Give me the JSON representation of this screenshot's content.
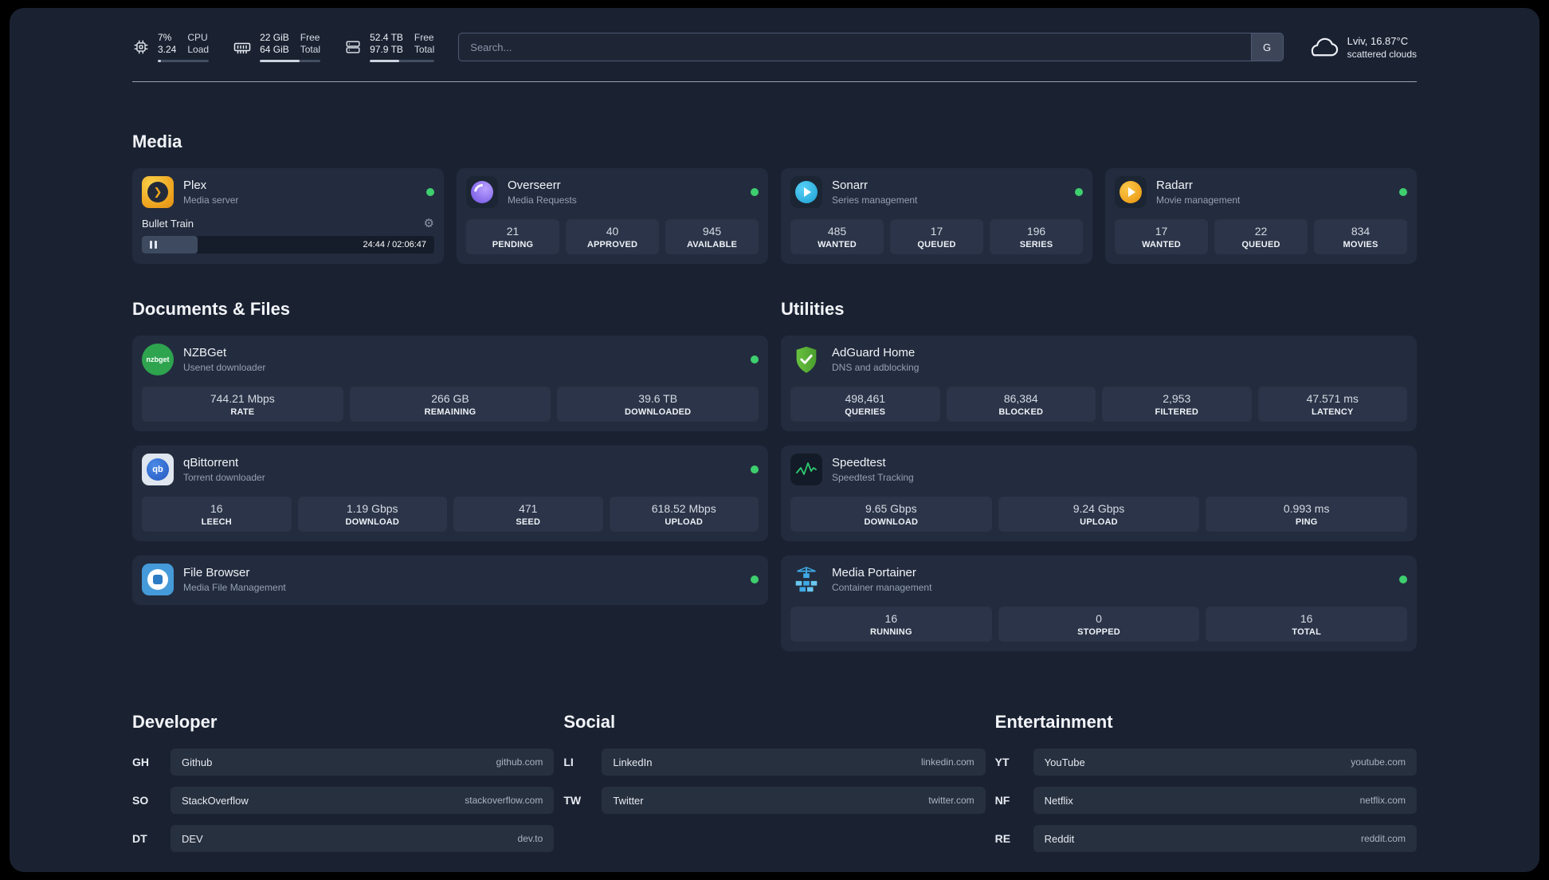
{
  "colors": {
    "status_online": "#3ecf6f",
    "background": "#1a2232",
    "card": "#232c3e"
  },
  "icons": {
    "settings_gear": "⚙"
  },
  "topbar": {
    "cpu": {
      "value1": "7%",
      "value2": "3.24",
      "label1": "CPU",
      "label2": "Load",
      "progress_percent": 7
    },
    "memory": {
      "value1": "22 GiB",
      "value2": "64 GiB",
      "label1": "Free",
      "label2": "Total",
      "progress_percent": 66
    },
    "storage": {
      "value1": "52.4 TB",
      "value2": "97.9 TB",
      "label1": "Free",
      "label2": "Total",
      "progress_percent": 46
    },
    "search": {
      "placeholder": "Search...",
      "engine_label": "G"
    },
    "weather": {
      "location": "Lviv, 16.87°C",
      "condition": "scattered clouds"
    }
  },
  "media": {
    "title": "Media",
    "plex": {
      "name": "Plex",
      "desc": "Media server",
      "now_playing": "Bullet Train",
      "time": "24:44 / 02:06:47",
      "progress_percent": 19
    },
    "overseerr": {
      "name": "Overseerr",
      "desc": "Media Requests",
      "stats": [
        {
          "value": "21",
          "label": "PENDING"
        },
        {
          "value": "40",
          "label": "APPROVED"
        },
        {
          "value": "945",
          "label": "AVAILABLE"
        }
      ]
    },
    "sonarr": {
      "name": "Sonarr",
      "desc": "Series management",
      "stats": [
        {
          "value": "485",
          "label": "WANTED"
        },
        {
          "value": "17",
          "label": "QUEUED"
        },
        {
          "value": "196",
          "label": "SERIES"
        }
      ]
    },
    "radarr": {
      "name": "Radarr",
      "desc": "Movie management",
      "stats": [
        {
          "value": "17",
          "label": "WANTED"
        },
        {
          "value": "22",
          "label": "QUEUED"
        },
        {
          "value": "834",
          "label": "MOVIES"
        }
      ]
    }
  },
  "documents": {
    "title": "Documents & Files",
    "nzbget": {
      "name": "NZBGet",
      "desc": "Usenet downloader",
      "icon_label": "nzbget",
      "stats": [
        {
          "value": "744.21 Mbps",
          "label": "RATE"
        },
        {
          "value": "266 GB",
          "label": "REMAINING"
        },
        {
          "value": "39.6 TB",
          "label": "DOWNLOADED"
        }
      ]
    },
    "qbittorrent": {
      "name": "qBittorrent",
      "desc": "Torrent downloader",
      "icon_label": "qb",
      "stats": [
        {
          "value": "16",
          "label": "LEECH"
        },
        {
          "value": "1.19 Gbps",
          "label": "DOWNLOAD"
        },
        {
          "value": "471",
          "label": "SEED"
        },
        {
          "value": "618.52 Mbps",
          "label": "UPLOAD"
        }
      ]
    },
    "filebrowser": {
      "name": "File Browser",
      "desc": "Media File Management"
    }
  },
  "utilities": {
    "title": "Utilities",
    "adguard": {
      "name": "AdGuard Home",
      "desc": "DNS and adblocking",
      "stats": [
        {
          "value": "498,461",
          "label": "QUERIES"
        },
        {
          "value": "86,384",
          "label": "BLOCKED"
        },
        {
          "value": "2,953",
          "label": "FILTERED"
        },
        {
          "value": "47.571 ms",
          "label": "LATENCY"
        }
      ]
    },
    "speedtest": {
      "name": "Speedtest",
      "desc": "Speedtest Tracking",
      "stats": [
        {
          "value": "9.65 Gbps",
          "label": "DOWNLOAD"
        },
        {
          "value": "9.24 Gbps",
          "label": "UPLOAD"
        },
        {
          "value": "0.993 ms",
          "label": "PING"
        }
      ]
    },
    "portainer": {
      "name": "Media Portainer",
      "desc": "Container management",
      "stats": [
        {
          "value": "16",
          "label": "RUNNING"
        },
        {
          "value": "0",
          "label": "STOPPED"
        },
        {
          "value": "16",
          "label": "TOTAL"
        }
      ]
    }
  },
  "bookmarks": {
    "developer": {
      "title": "Developer",
      "items": [
        {
          "abbr": "GH",
          "name": "Github",
          "url": "github.com"
        },
        {
          "abbr": "SO",
          "name": "StackOverflow",
          "url": "stackoverflow.com"
        },
        {
          "abbr": "DT",
          "name": "DEV",
          "url": "dev.to"
        }
      ]
    },
    "social": {
      "title": "Social",
      "items": [
        {
          "abbr": "LI",
          "name": "LinkedIn",
          "url": "linkedin.com"
        },
        {
          "abbr": "TW",
          "name": "Twitter",
          "url": "twitter.com"
        }
      ]
    },
    "entertainment": {
      "title": "Entertainment",
      "items": [
        {
          "abbr": "YT",
          "name": "YouTube",
          "url": "youtube.com"
        },
        {
          "abbr": "NF",
          "name": "Netflix",
          "url": "netflix.com"
        },
        {
          "abbr": "RE",
          "name": "Reddit",
          "url": "reddit.com"
        }
      ]
    }
  }
}
